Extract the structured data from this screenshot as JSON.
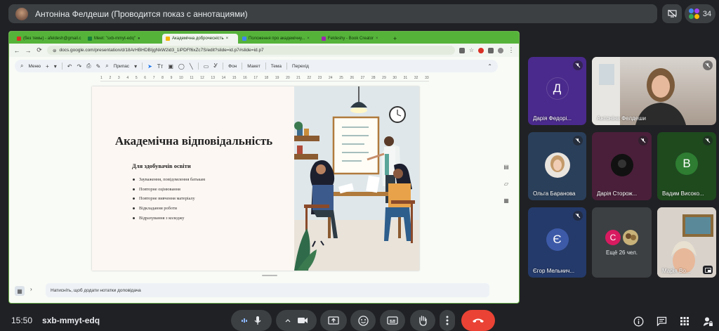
{
  "meeting": {
    "presenter_banner": "Антоніна Фелдеши (Проводится показ с аннотациями)",
    "participant_count": "34",
    "time": "15:50",
    "code": "sxb-mmyt-edq"
  },
  "browser": {
    "tabs": [
      {
        "label": "(без темы) - afeldesh@gmail.c",
        "active": false,
        "color": "#d93025"
      },
      {
        "label": "Meet: \"sxb-mmyt-edq\"",
        "active": false,
        "color": "#188038"
      },
      {
        "label": "Академічна доброчесність",
        "active": true,
        "color": "#f4b400"
      },
      {
        "label": "Положення про академічну...",
        "active": false,
        "color": "#f4b400"
      },
      {
        "label": "Feldeshy - Book Creator",
        "active": false,
        "color": "#9c27b0"
      }
    ],
    "url": "docs.google.com/presentation/d/18ArHBHDBIjgNkW2id3_1iPDFf6xZc7S/edit?slide=id.p7#slide=id.p7"
  },
  "slides_toolbar": {
    "menu": "Меню",
    "zoom": "Припас",
    "bg": "Фон",
    "layout": "Макет",
    "theme": "Тема",
    "transition": "Перехід"
  },
  "ruler": [
    "1",
    "2",
    "3",
    "4",
    "5",
    "6",
    "7",
    "8",
    "9",
    "10",
    "11",
    "12",
    "13",
    "14",
    "15",
    "16",
    "17",
    "18",
    "19",
    "20",
    "21",
    "22",
    "23",
    "24",
    "25",
    "26",
    "27",
    "28",
    "29",
    "30",
    "31",
    "32",
    "33"
  ],
  "slide": {
    "title": "Академічна відповідальність",
    "subtitle": "Для здобувачів освіти",
    "bullets": [
      "Зауваження, повідомлення батькам",
      "Повторне оцінювання",
      "Повторне вивчення матеріалу",
      "Відкладання роботи",
      "Відрахування з коледжу"
    ]
  },
  "notes_placeholder": "Натисніть, щоб додати нотатки доповідача",
  "participants": [
    {
      "name": "Дарія Федорі...",
      "letter": "Д",
      "bg": "#4a2a8c",
      "circle": "#4a2a8c"
    },
    {
      "name": "Антоніна Фелдеши"
    },
    {
      "name": "Ольга Баранова"
    },
    {
      "name": "Дарія Сторож..."
    },
    {
      "name": "Вадим Високо...",
      "letter": "В",
      "bg": "#1e5a1e",
      "circle": "#2e7d32"
    },
    {
      "name": "Єгор Мельнич...",
      "letter": "Є",
      "bg": "#2a3f7a",
      "circle": "#3d5aa8"
    },
    {
      "name": "Ещё 26 чел.",
      "letter": "С"
    },
    {
      "name": "Марія Во..."
    }
  ]
}
